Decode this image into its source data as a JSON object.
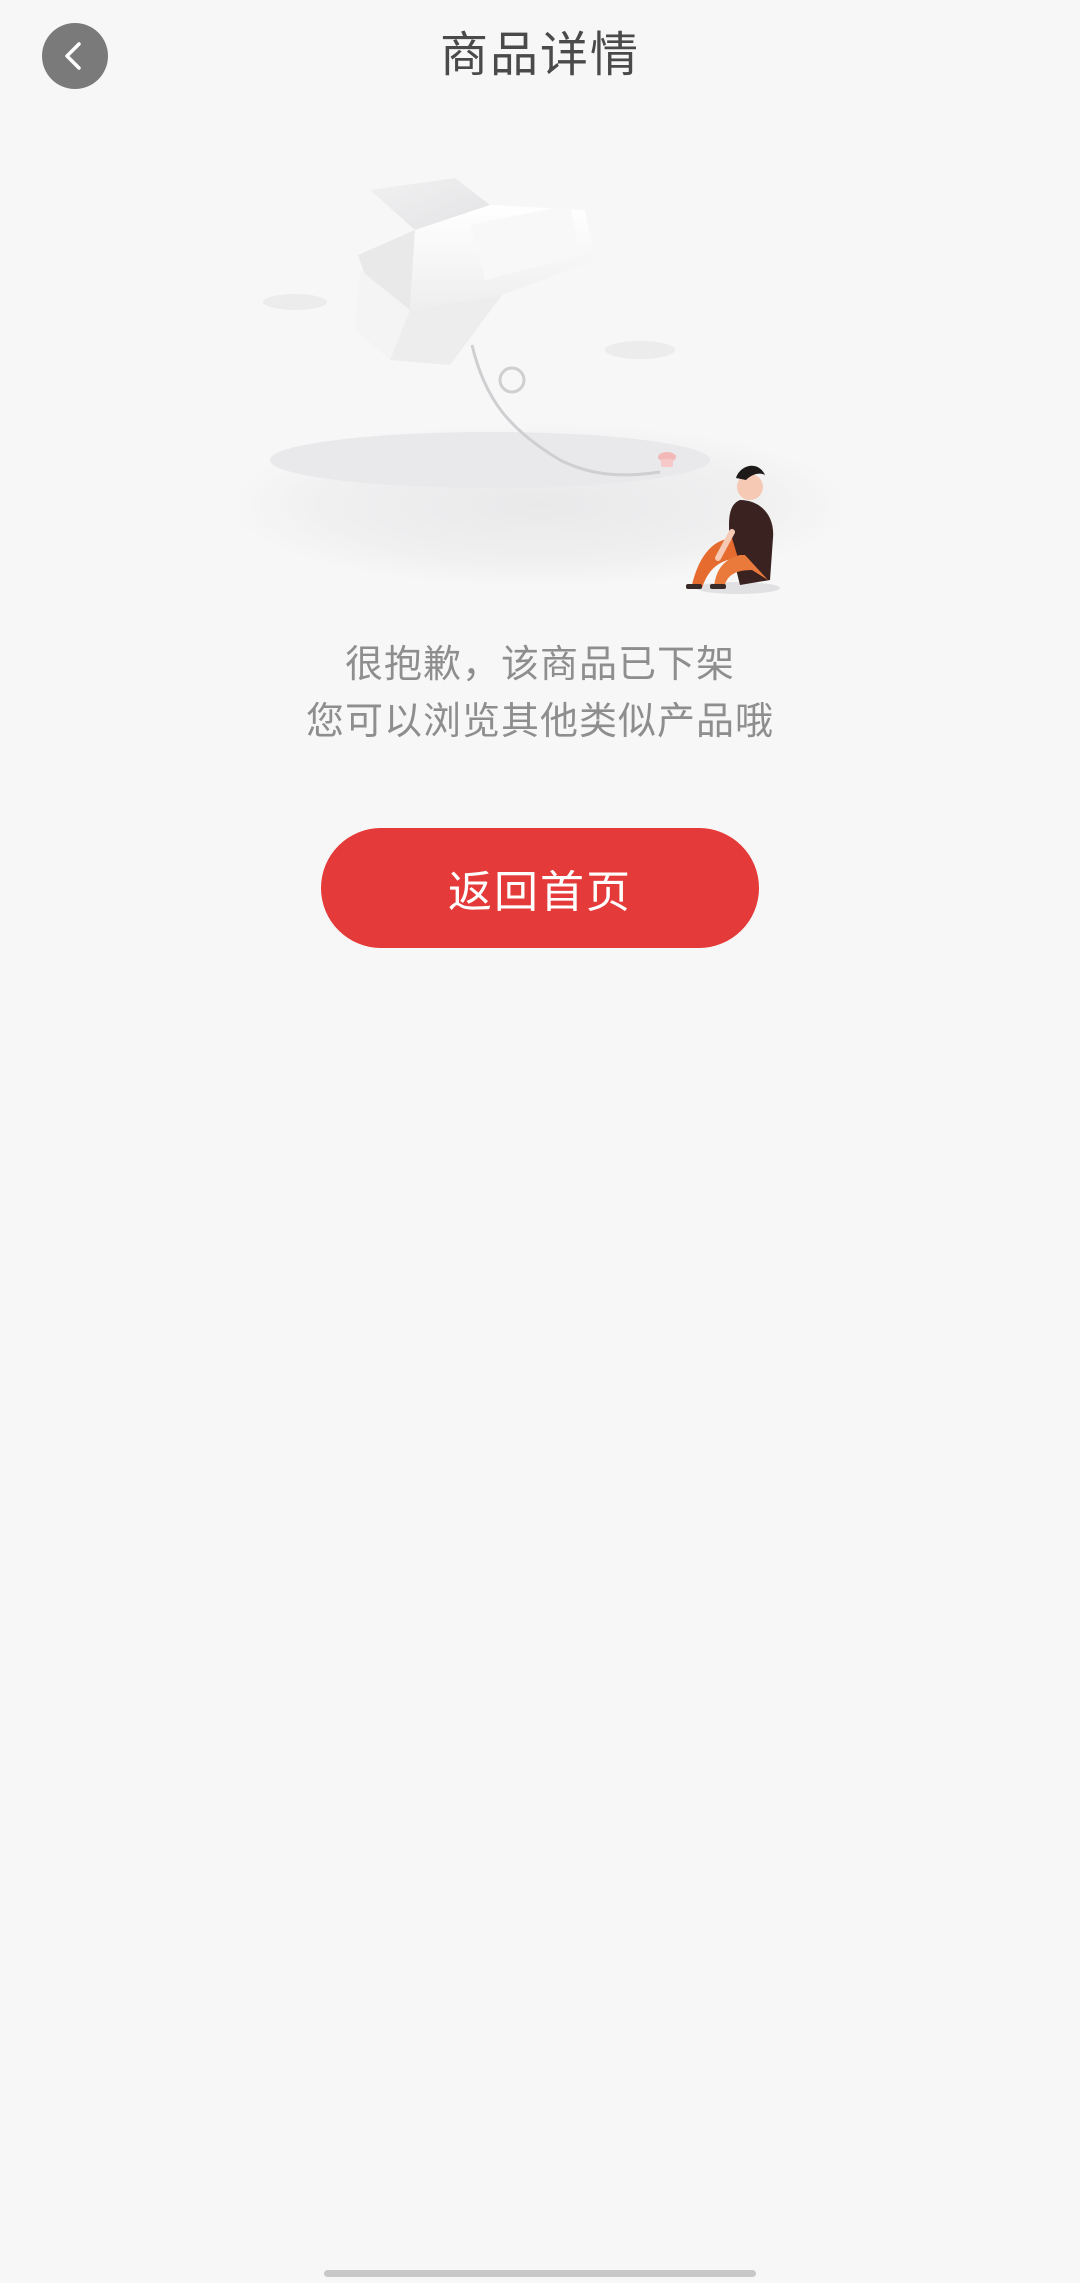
{
  "header": {
    "title": "商品详情",
    "back_icon": "chevron-left-icon"
  },
  "illustration": {
    "description_icon": "empty-state-icon"
  },
  "message": {
    "line1": "很抱歉，该商品已下架",
    "line2": "您可以浏览其他类似产品哦"
  },
  "actions": {
    "home_label": "返回首页"
  },
  "colors": {
    "background": "#f7f7f7",
    "accent": "#e53a3a",
    "title_text": "#4a4a4a",
    "message_text": "#8e8e8e",
    "back_button": "#7a7a7a"
  }
}
